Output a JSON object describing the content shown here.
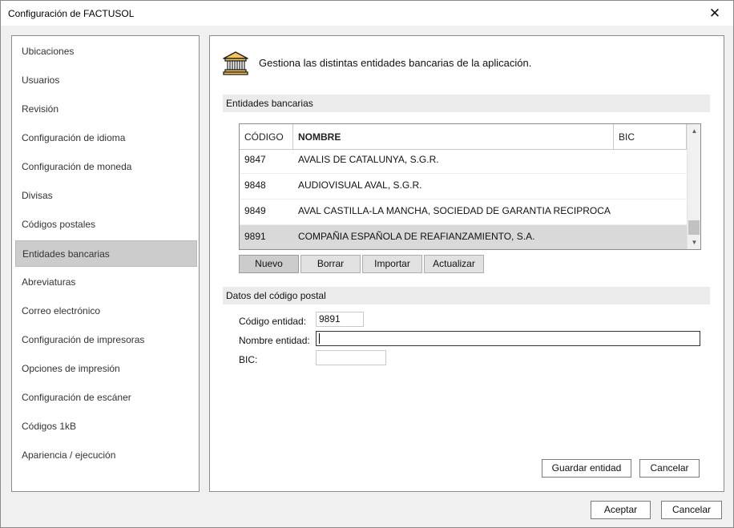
{
  "window": {
    "title": "Configuración de FACTUSOL",
    "close_glyph": "✕"
  },
  "sidebar": {
    "items": [
      {
        "label": "Ubicaciones"
      },
      {
        "label": "Usuarios"
      },
      {
        "label": "Revisión"
      },
      {
        "label": "Configuración de idioma"
      },
      {
        "label": "Configuración de moneda"
      },
      {
        "label": "Divisas"
      },
      {
        "label": "Códigos postales"
      },
      {
        "label": "Entidades bancarias"
      },
      {
        "label": "Abreviaturas"
      },
      {
        "label": "Correo electrónico"
      },
      {
        "label": "Configuración de impresoras"
      },
      {
        "label": "Opciones de impresión"
      },
      {
        "label": "Configuración de escáner"
      },
      {
        "label": "Códigos 1kB"
      },
      {
        "label": "Apariencia / ejecución"
      }
    ],
    "selected": "Entidades bancarias"
  },
  "main": {
    "icon": "bank-icon",
    "description": "Gestiona las distintas entidades bancarias de la aplicación.",
    "list_section_title": "Entidades bancarias",
    "table": {
      "columns": [
        "CÓDIGO",
        "NOMBRE",
        "BIC"
      ],
      "rows": [
        {
          "codigo": "9847",
          "nombre": "AVALIS DE CATALUNYA, S.G.R.",
          "bic": ""
        },
        {
          "codigo": "9848",
          "nombre": "AUDIOVISUAL AVAL, S.G.R.",
          "bic": ""
        },
        {
          "codigo": "9849",
          "nombre": "AVAL CASTILLA-LA MANCHA, SOCIEDAD DE GARANTIA RECIPROCA",
          "bic": ""
        },
        {
          "codigo": "9891",
          "nombre": "COMPAÑIA ESPAÑOLA DE REAFIANZAMIENTO, S.A.",
          "bic": ""
        }
      ],
      "selected_codigo": "9891",
      "scroll_up_glyph": "▲",
      "scroll_down_glyph": "▼"
    },
    "table_buttons": {
      "nuevo": "Nuevo",
      "borrar": "Borrar",
      "importar": "Importar",
      "actualizar": "Actualizar"
    },
    "form_section_title": "Datos del código postal",
    "form": {
      "codigo_label": "Código entidad:",
      "codigo_value": "9891",
      "nombre_label": "Nombre entidad:",
      "nombre_value": "",
      "bic_label": "BIC:",
      "bic_value": ""
    },
    "form_buttons": {
      "guardar": "Guardar entidad",
      "cancelar": "Cancelar"
    }
  },
  "footer": {
    "aceptar": "Aceptar",
    "cancelar": "Cancelar"
  }
}
